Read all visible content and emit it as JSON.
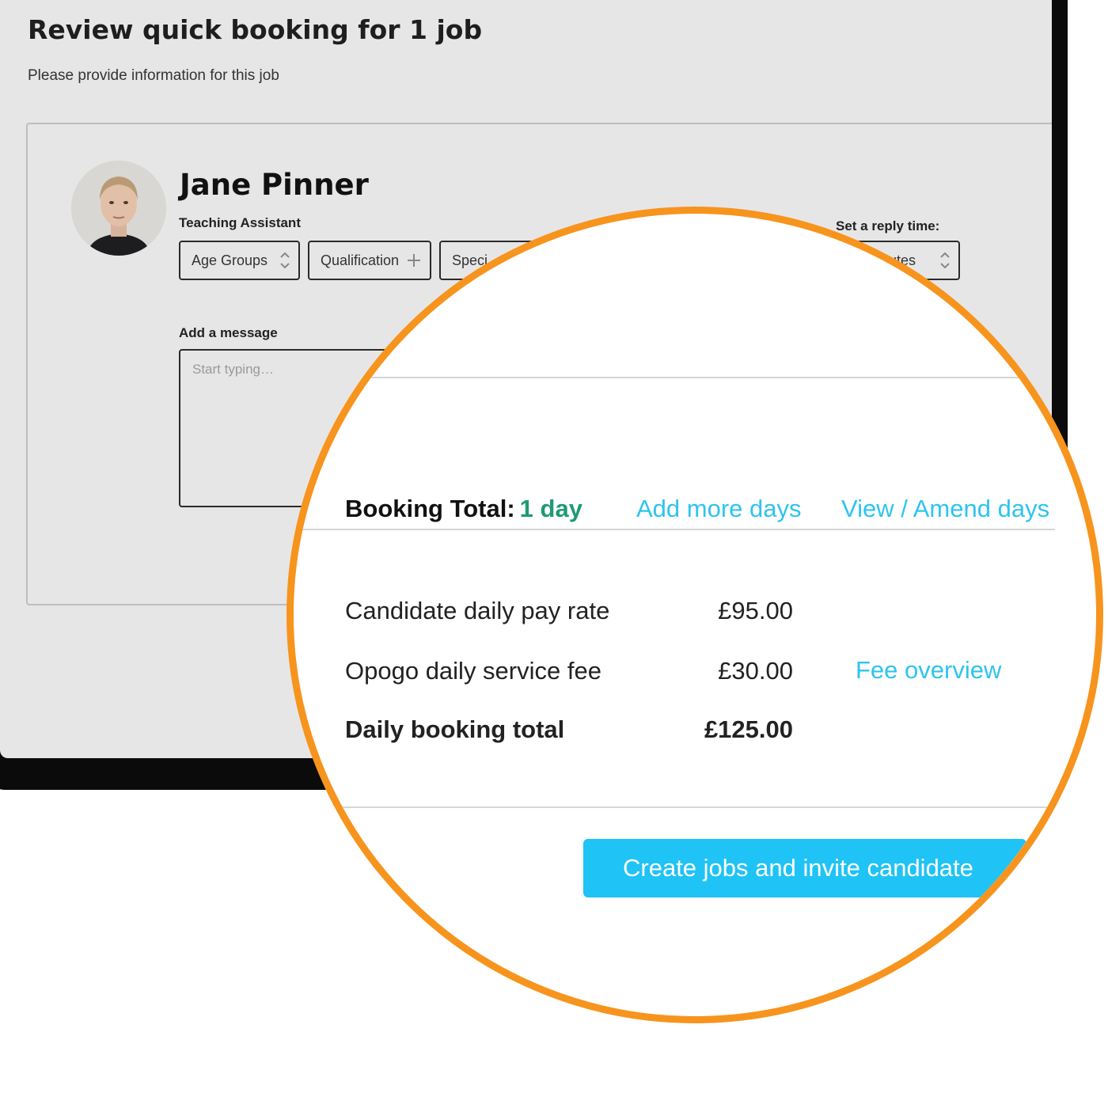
{
  "page": {
    "title": "Review quick booking for 1 job",
    "subtitle": "Please provide information for this job"
  },
  "candidate": {
    "name": "Jane Pinner",
    "role": "Teaching Assistant"
  },
  "filters": {
    "age_groups": "Age Groups",
    "qualification": "Qualification",
    "specialism_partial": "Speci"
  },
  "reply_time": {
    "label": "Set a reply time:",
    "value_partial": "utes"
  },
  "message": {
    "label": "Add a message",
    "placeholder": "Start typing…"
  },
  "booking": {
    "total_label": "Booking Total:",
    "days": "1 day",
    "add_days_link": "Add more days",
    "amend_days_link": "View / Amend days"
  },
  "fees": [
    {
      "label": "Candidate daily pay rate",
      "value": "£95.00"
    },
    {
      "label": "Opogo daily service fee",
      "value": "£30.00",
      "link": "Fee overview"
    },
    {
      "label": "Daily booking total",
      "value": "£125.00"
    }
  ],
  "cta": {
    "label": "Create jobs and invite candidate"
  },
  "colors": {
    "accent_orange": "#f7941d",
    "link_blue": "#2ec4ef",
    "button_blue": "#1fc3f5",
    "days_green": "#1f9a74",
    "background_grey": "#e6e6e6"
  }
}
